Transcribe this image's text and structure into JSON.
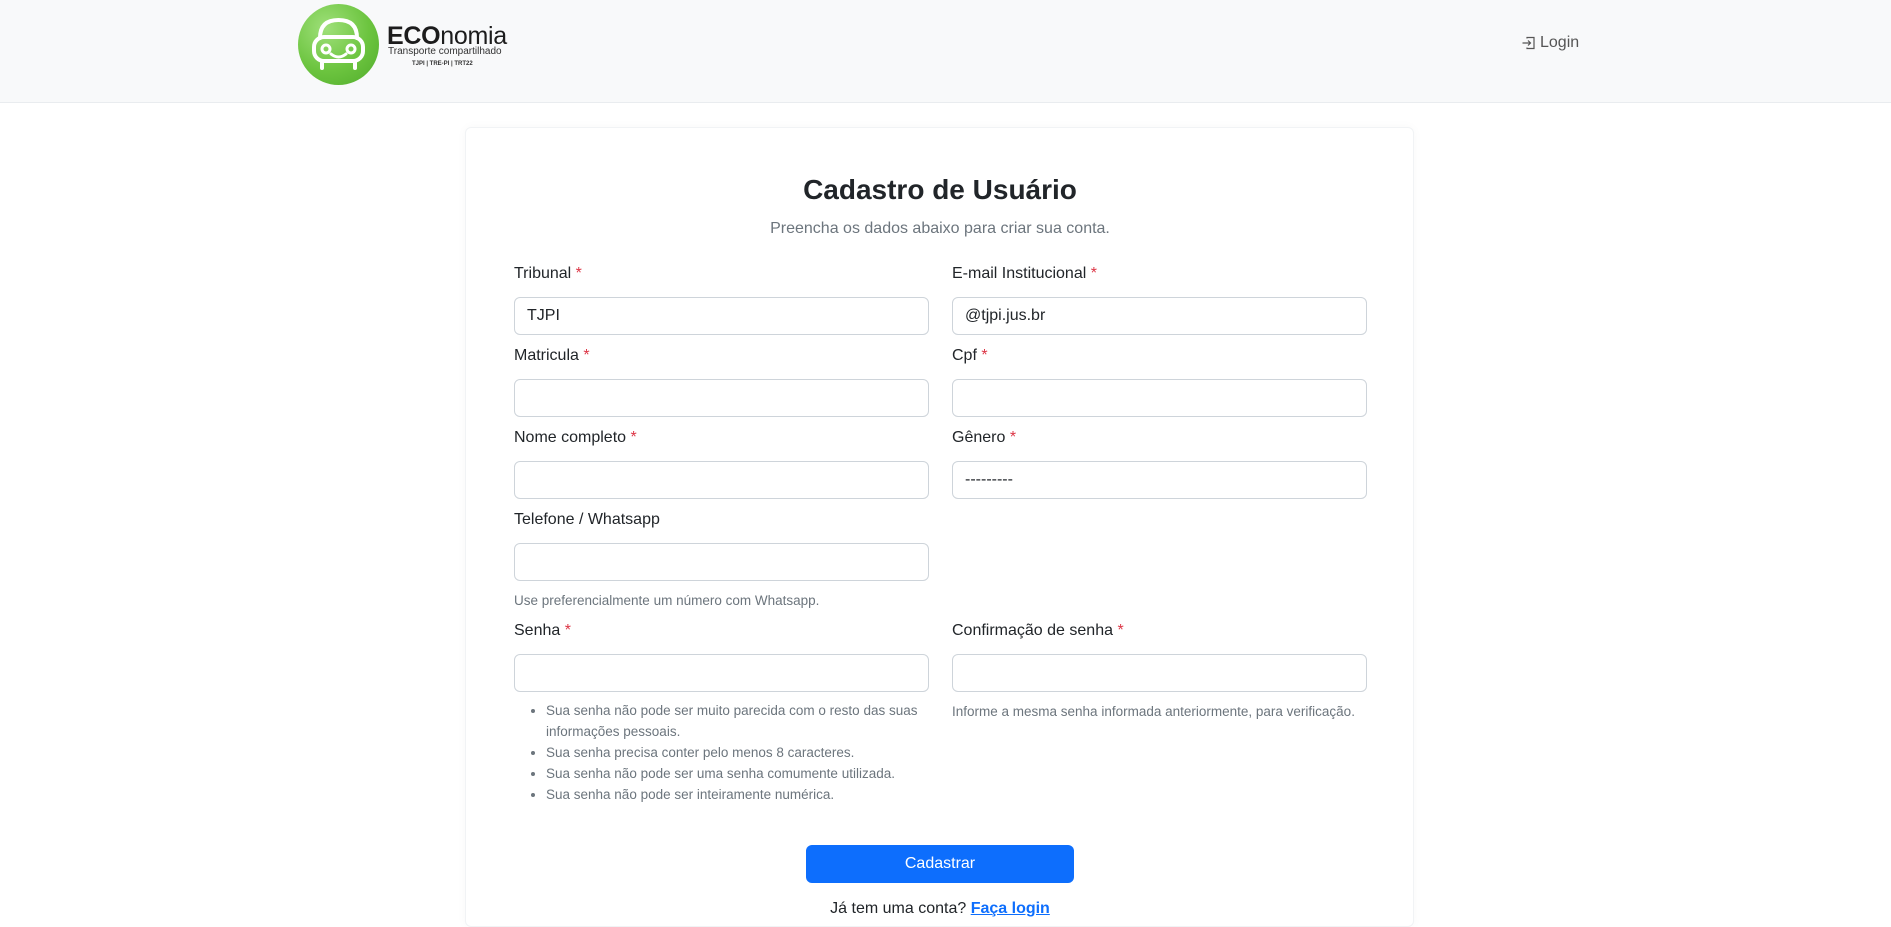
{
  "header": {
    "brand_bold": "ECO",
    "brand_rest": "nomia",
    "tagline": "Transporte compartilhado",
    "orgs": "TJPI | TRE-PI | TRT22",
    "login_label": "Login"
  },
  "form": {
    "title": "Cadastro de Usuário",
    "subtitle": "Preencha os dados abaixo para criar sua conta.",
    "required_mark": "*",
    "tribunal": {
      "label": "Tribunal",
      "value": "TJPI"
    },
    "email": {
      "label": "E-mail Institucional",
      "value": "@tjpi.jus.br"
    },
    "matricula": {
      "label": "Matricula",
      "value": ""
    },
    "cpf": {
      "label": "Cpf",
      "value": ""
    },
    "nome": {
      "label": "Nome completo",
      "value": ""
    },
    "genero": {
      "label": "Gênero",
      "value": "---------"
    },
    "telefone": {
      "label": "Telefone / Whatsapp",
      "value": "",
      "help": "Use preferencialmente um número com Whatsapp."
    },
    "senha": {
      "label": "Senha",
      "value": "",
      "rules": [
        "Sua senha não pode ser muito parecida com o resto das suas informações pessoais.",
        "Sua senha precisa conter pelo menos 8 caracteres.",
        "Sua senha não pode ser uma senha comumente utilizada.",
        "Sua senha não pode ser inteiramente numérica."
      ]
    },
    "confirmacao": {
      "label": "Confirmação de senha",
      "value": "",
      "help": "Informe a mesma senha informada anteriormente, para verificação."
    },
    "submit_label": "Cadastrar",
    "footer_text": "Já tem uma conta?",
    "footer_link": "Faça login"
  },
  "colors": {
    "primary": "#0d6efd",
    "required": "#dc3545",
    "brand_green": "#6cc43f"
  },
  "icons": {
    "login": "box-arrow-in-right-icon",
    "logo": "car-face-logo-icon"
  }
}
